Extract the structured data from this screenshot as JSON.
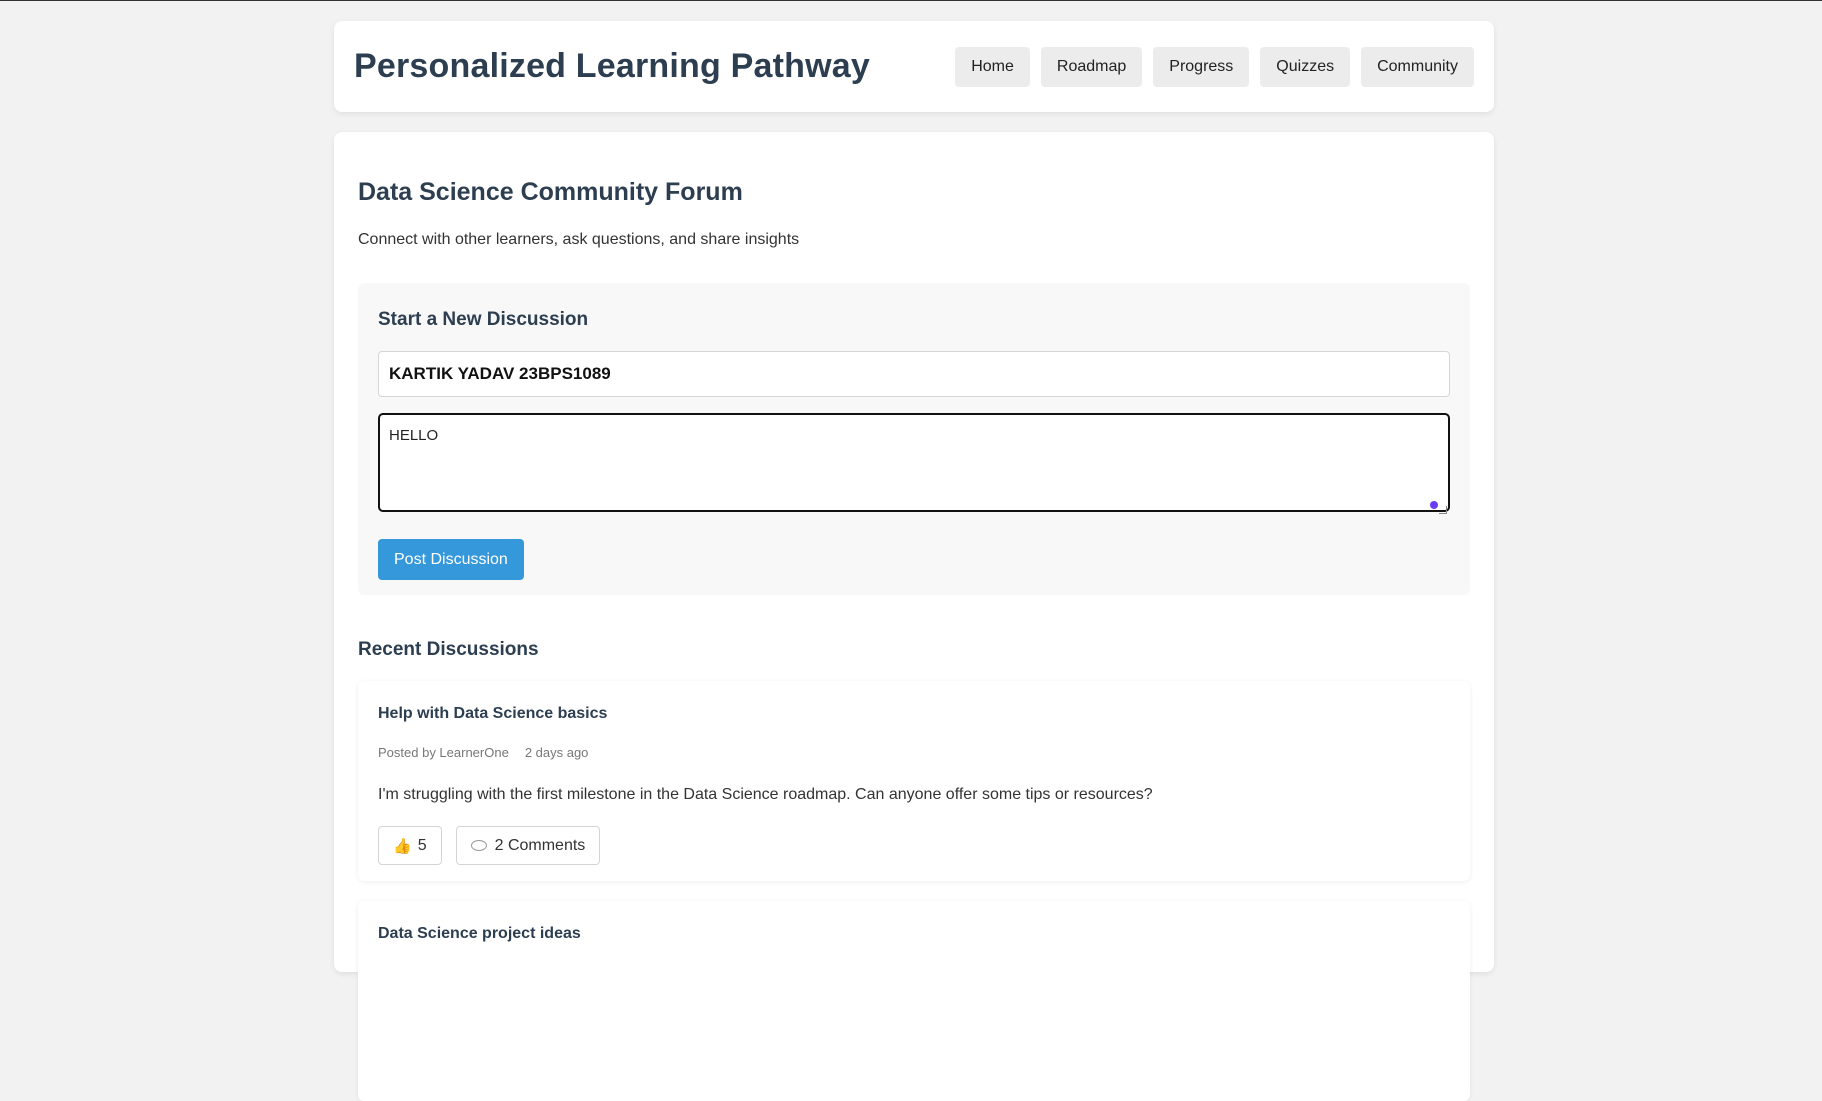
{
  "app": {
    "title": "Personalized Learning Pathway"
  },
  "nav": {
    "items": [
      "Home",
      "Roadmap",
      "Progress",
      "Quizzes",
      "Community"
    ]
  },
  "forum": {
    "title": "Data Science Community Forum",
    "subtitle": "Connect with other learners, ask questions, and share insights"
  },
  "new_discussion": {
    "heading": "Start a New Discussion",
    "title_value": "KARTIK YADAV 23BPS1089",
    "body_value": "HELLO",
    "post_label": "Post Discussion"
  },
  "recent": {
    "heading": "Recent Discussions",
    "discussions": [
      {
        "title": "Help with Data Science basics",
        "author": "Posted by LearnerOne",
        "time": "2 days ago",
        "body": "I'm struggling with the first milestone in the Data Science roadmap. Can anyone offer some tips or resources?",
        "likes": "5",
        "comments": "2 Comments"
      },
      {
        "title": "Data Science project ideas"
      }
    ]
  },
  "colors": {
    "accent": "#3498db",
    "heading": "#2c3e50",
    "background": "#f2f2f2"
  },
  "icons": {
    "like": "thumbs-up-icon",
    "comment": "comment-bubble-icon"
  }
}
